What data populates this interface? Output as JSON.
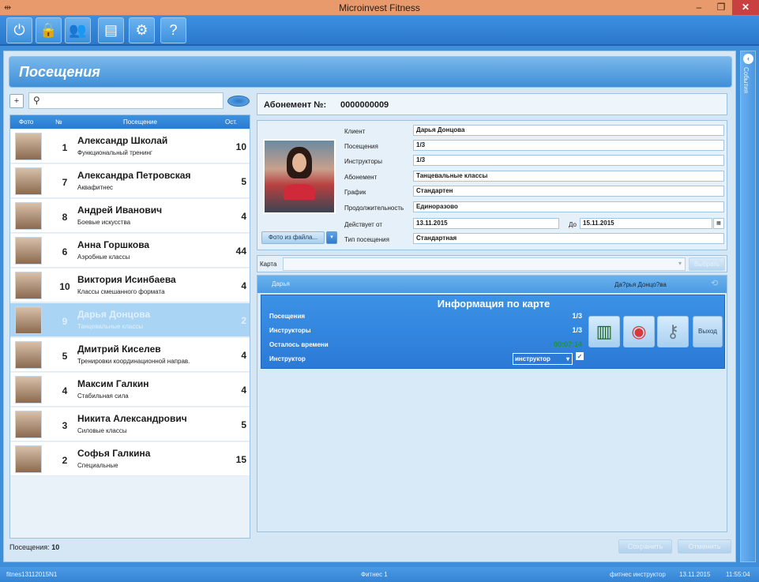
{
  "window": {
    "title": "Microinvest Fitness",
    "min_glyph": "–",
    "max_glyph": "❐",
    "close_glyph": "✕"
  },
  "toolbar": {
    "buttons": [
      {
        "name": "power",
        "glyph": "⏻"
      },
      {
        "name": "lock-user",
        "glyph": "🔒"
      },
      {
        "name": "users",
        "glyph": "👥"
      },
      {
        "name": "calendar",
        "glyph": "▤"
      },
      {
        "name": "settings",
        "glyph": "⚙"
      },
      {
        "name": "help-book",
        "glyph": "?"
      }
    ]
  },
  "section": {
    "title": "Посещения"
  },
  "sidebar": {
    "label": "События",
    "toggle_glyph": "‹"
  },
  "search": {
    "value": "",
    "placeholder": "",
    "add_glyph": "+",
    "search_glyph": "⚲"
  },
  "list": {
    "headers": {
      "photo": "Фото",
      "num": "№",
      "visit": "Посещение",
      "left": "Ост."
    },
    "rows": [
      {
        "num": "1",
        "name": "Александр Школай",
        "sub": "Функциональный тренинг",
        "left": "10"
      },
      {
        "num": "7",
        "name": "Александра Петровская",
        "sub": "Аквафитнес",
        "left": "5"
      },
      {
        "num": "8",
        "name": "Андрей Иванович",
        "sub": "Боевые искусства",
        "left": "4"
      },
      {
        "num": "6",
        "name": "Анна Горшкова",
        "sub": "Аэробные классы",
        "left": "44"
      },
      {
        "num": "10",
        "name": "Виктория Исинбаева",
        "sub": "Классы смешанного формата",
        "left": "4"
      },
      {
        "num": "9",
        "name": "Дарья Донцова",
        "sub": "Танцевальные классы",
        "left": "2"
      },
      {
        "num": "5",
        "name": "Дмитрий Киселев",
        "sub": "Тренировки координационной направ.",
        "left": "4"
      },
      {
        "num": "4",
        "name": "Максим Галкин",
        "sub": "Стабильная сила",
        "left": "4"
      },
      {
        "num": "3",
        "name": "Никита Александрович",
        "sub": "Силовые классы",
        "left": "5"
      },
      {
        "num": "2",
        "name": "Софья Галкина",
        "sub": "Специальные",
        "left": "15"
      }
    ]
  },
  "footer": {
    "visits_label": "Посещения:",
    "visits_count": "10",
    "save_label": "Сохранить",
    "cancel_label": "Отменить"
  },
  "abonement": {
    "label": "Абонемент №:",
    "number": "0000000009"
  },
  "client": {
    "photo_button": "Фото из файла...",
    "photo_dropdown_glyph": "▾",
    "fields": {
      "client_label": "Клиент",
      "client_value": "Дарья Донцова",
      "visits_label": "Посещения",
      "visits_value": "1/3",
      "instructors_label": "Инструкторы",
      "instructors_value": "1/3",
      "abonement_label": "Абонемент",
      "abonement_value": "Танцевальные классы",
      "schedule_label": "График",
      "schedule_value": "Стандартен",
      "duration_label": "Продолжительность",
      "duration_value": "Единоразово",
      "valid_from_label": "Действует от",
      "valid_from_value": "13.11.2015",
      "valid_to_label": "До",
      "valid_to_value": "15.11.2015",
      "visit_type_label": "Тип посещения",
      "visit_type_value": "Стандартная"
    },
    "date_glyph": "▦"
  },
  "card": {
    "label": "Карта",
    "value": "",
    "arrow": "▾",
    "select_button": "Выбрать"
  },
  "info": {
    "header_left": "Дарья",
    "header_right": "Да?рья Донцо?ва",
    "header_icon": "⟲",
    "title": "Информация по карте",
    "visits_label": "Посещения",
    "visits_value": "1/3",
    "instructors_label": "Инструкторы",
    "instructors_value": "1/3",
    "time_left_label": "Осталось времени",
    "time_left_value": "00:07:14",
    "instructor_label": "Инструктор",
    "instructor_select": "инструктор",
    "instructor_arrow": "▾",
    "check_glyph": "✓",
    "action_buttons": [
      {
        "name": "towel",
        "glyph": "▥"
      },
      {
        "name": "bracelet",
        "glyph": "◉"
      },
      {
        "name": "keys",
        "glyph": "⚷"
      }
    ],
    "exit_label": "Выход"
  },
  "statusbar": {
    "host": "fitnes13112015N1",
    "app": "Фитнес 1",
    "user": "фитнес инструктор",
    "date": "13.11.2015",
    "time": "11:55:04"
  },
  "colors": {
    "accent": "#2b7ad0",
    "selected_row": "#a9d4f4",
    "titlebar": "#e89a6c",
    "close": "#c94040"
  }
}
